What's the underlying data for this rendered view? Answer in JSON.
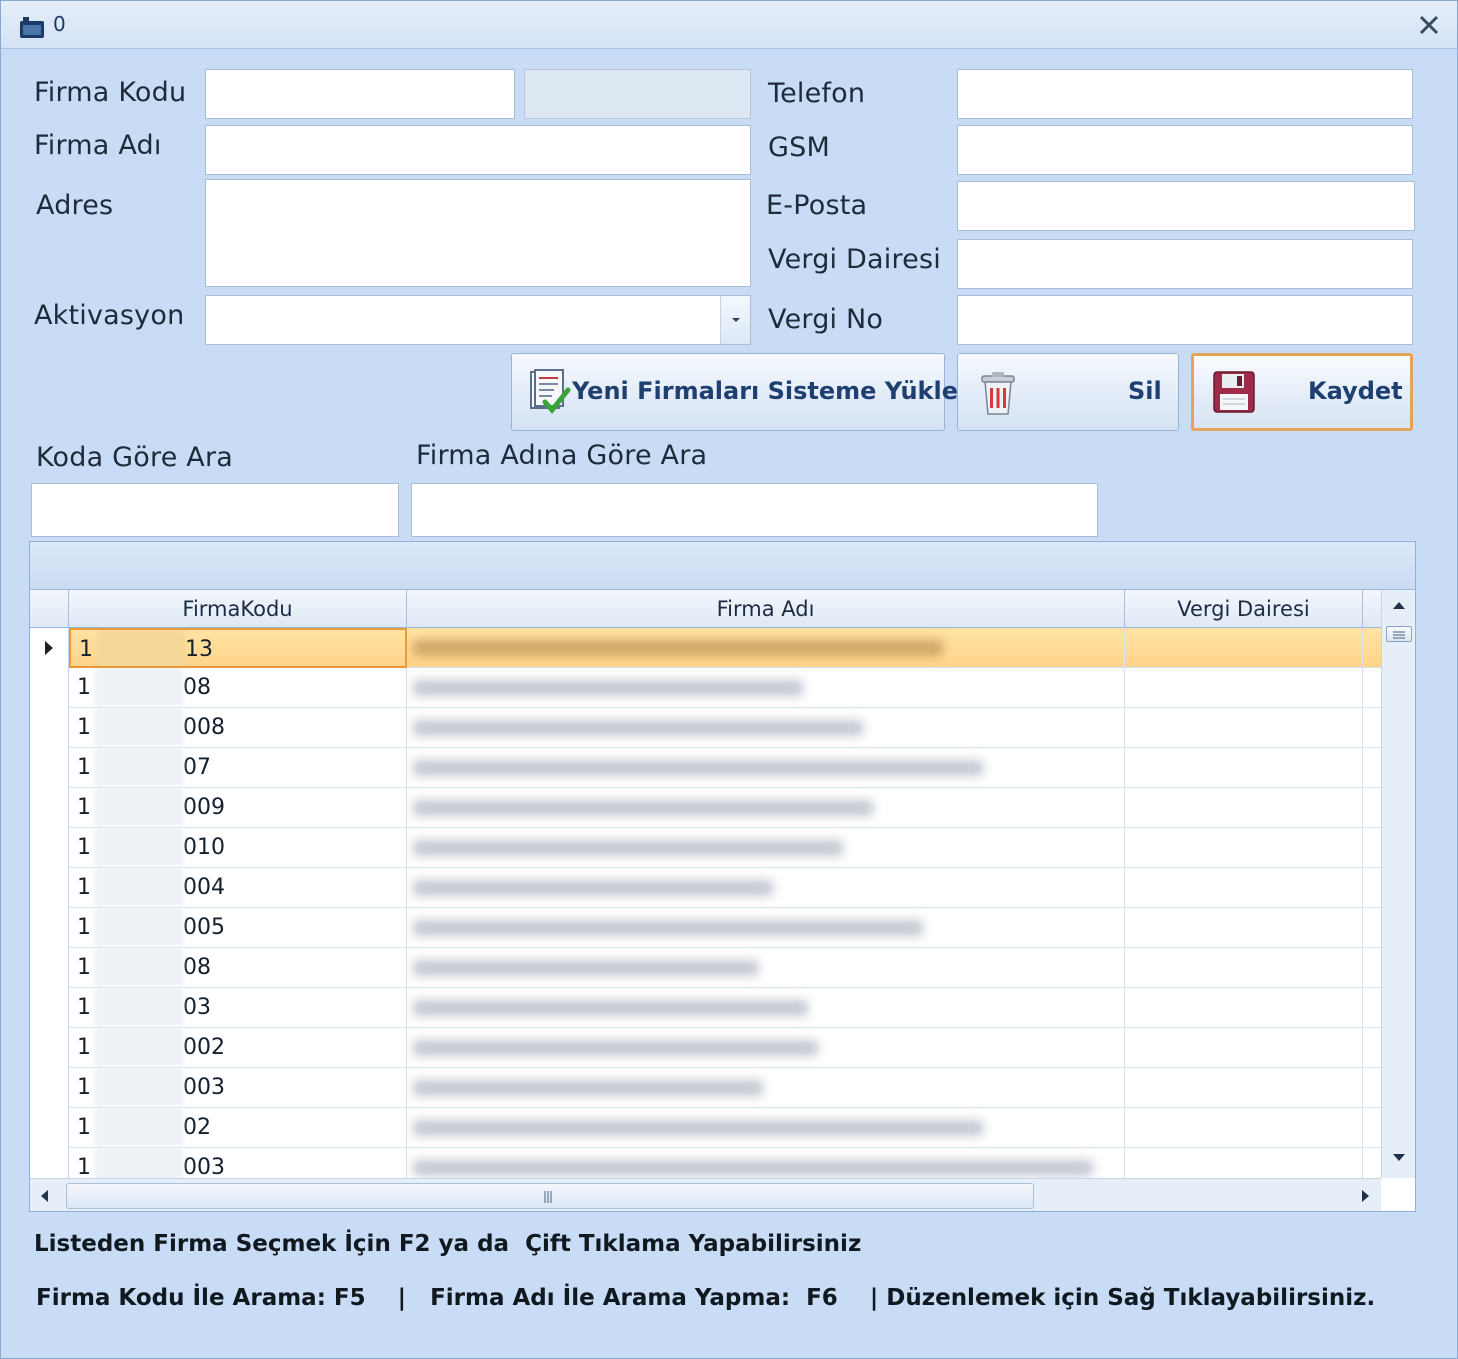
{
  "window": {
    "title": "0"
  },
  "form": {
    "firma_kodu_label": "Firma Kodu",
    "firma_adi_label": "Firma Adı",
    "adres_label": "Adres",
    "aktivasyon_label": "Aktivasyon",
    "telefon_label": "Telefon",
    "gsm_label": "GSM",
    "eposta_label": "E-Posta",
    "vergi_dairesi_label": "Vergi Dairesi",
    "vergi_no_label": "Vergi No"
  },
  "buttons": {
    "upload_label": "Yeni Firmaları Sisteme Yükle",
    "delete_label": "Sil",
    "save_label": "Kaydet"
  },
  "search": {
    "by_code_label": "Koda Göre Ara",
    "by_name_label": "Firma Adına Göre Ara"
  },
  "grid": {
    "columns": [
      "FirmaKodu",
      "Firma Adı",
      "Vergi Dairesi"
    ],
    "rows": [
      {
        "code_start": "1",
        "code_end": "13"
      },
      {
        "code_start": "1",
        "code_end": "08"
      },
      {
        "code_start": "1",
        "code_end": "008"
      },
      {
        "code_start": "1",
        "code_end": "07"
      },
      {
        "code_start": "1",
        "code_end": "009"
      },
      {
        "code_start": "1",
        "code_end": "010"
      },
      {
        "code_start": "1",
        "code_end": "004"
      },
      {
        "code_start": "1",
        "code_end": "005"
      },
      {
        "code_start": "1",
        "code_end": "08"
      },
      {
        "code_start": "1",
        "code_end": "03"
      },
      {
        "code_start": "1",
        "code_end": "002"
      },
      {
        "code_start": "1",
        "code_end": "003"
      },
      {
        "code_start": "1",
        "code_end": "02"
      },
      {
        "code_start": "1",
        "code_end": "003"
      }
    ]
  },
  "hints": {
    "line1": "Listeden Firma Seçmek İçin F2 ya da  Çift Tıklama Yapabilirsiniz",
    "line2": "Firma Kodu İle Arama: F5    |   Firma Adı İle Arama Yapma:  F6    | Düzenlemek için Sağ Tıklayabilirsiniz."
  },
  "colors": {
    "window_bg": "#c9dcf5",
    "selected_row": "#ffd48a",
    "focus_border": "#e89a3a",
    "button_text": "#1f3f70"
  },
  "icons": [
    "app-window-icon",
    "close-icon",
    "document-check-icon",
    "trash-icon",
    "floppy-disk-icon",
    "row-pointer-icon",
    "scroll-up-icon",
    "scroll-down-icon",
    "scroll-left-icon",
    "scroll-right-icon"
  ]
}
